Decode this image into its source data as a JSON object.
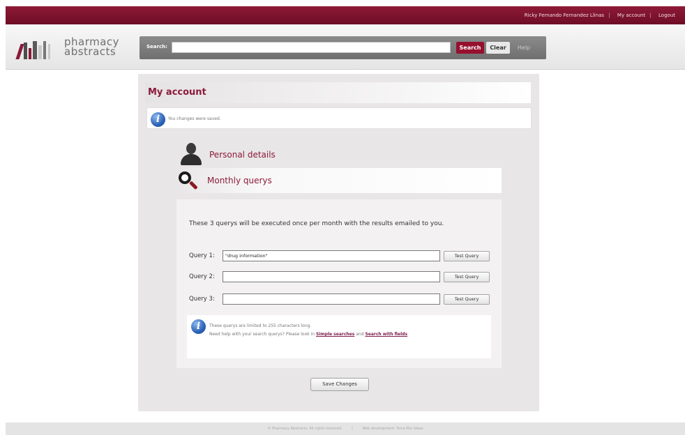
{
  "topbar": {
    "user_name": "Ricky Fernando Fernandez Llinas",
    "separator": "|",
    "my_account": "My account",
    "logout": "Logout"
  },
  "logo": {
    "line1": "pharmacy",
    "line2": "abstracts",
    "bar_colors": [
      "#8b1a3a",
      "#4e4e4e",
      "#8b1a3a",
      "#5a5a5a",
      "#c9c9c9",
      "#777777"
    ]
  },
  "search": {
    "label": "Search:",
    "value": "",
    "placeholder": "",
    "search_button": "Search",
    "clear_button": "Clear",
    "help_link": "Help"
  },
  "page": {
    "title": "My account",
    "notice": "You changes were saved."
  },
  "sections": {
    "personal": "Personal details",
    "monthly": "Monthly querys"
  },
  "queries": {
    "intro": "These 3 querys will be executed once per month with the results emailed to you.",
    "rows": [
      {
        "label": "Query 1:",
        "value": "\"drug information\"",
        "button": "Test Query"
      },
      {
        "label": "Query 2:",
        "value": "",
        "button": "Test Query"
      },
      {
        "label": "Query 3:",
        "value": "",
        "button": "Test Query"
      }
    ],
    "tip_line1": "These querys are limited to 255 characters long.",
    "tip_line2_prefix": "Need help with your search querys? Please look in",
    "tip_link1": "Simple searches",
    "tip_and": "and",
    "tip_link2": "Search with fields",
    "save_button": "Save Changes"
  },
  "footer": {
    "left": "© Pharmacy Abstracts. All rights reserved.",
    "sep": "|",
    "right": "Web development: Terra Mar Ideas"
  },
  "colors": {
    "brand": "#8b1a3a",
    "topbar": "#7a1430",
    "search_button": "#96102e",
    "info_blue": "#2b63b8"
  }
}
